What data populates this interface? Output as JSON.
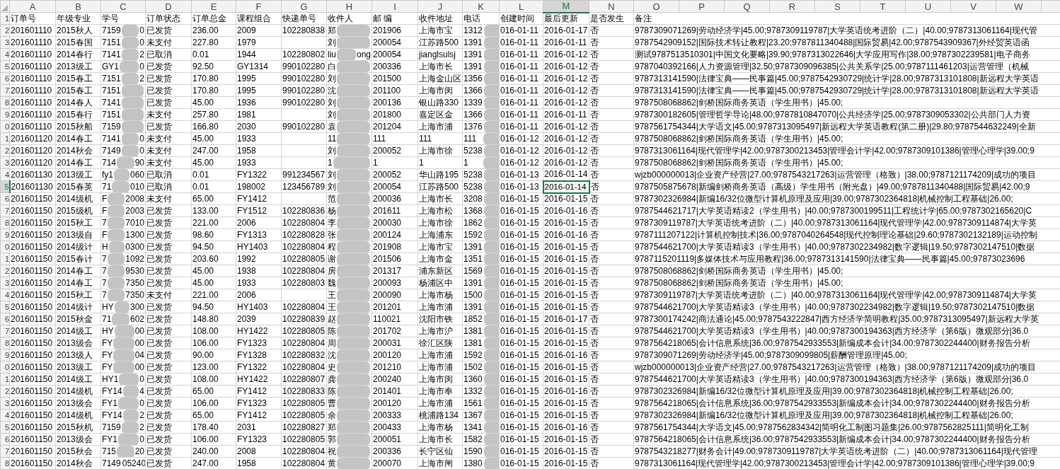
{
  "column_headers": [
    {
      "label": "A",
      "selected": false
    },
    {
      "label": "B",
      "selected": false
    },
    {
      "label": "C",
      "selected": false
    },
    {
      "label": "D",
      "selected": false
    },
    {
      "label": "E",
      "selected": false
    },
    {
      "label": "F",
      "selected": false
    },
    {
      "label": "G",
      "selected": false
    },
    {
      "label": "H",
      "selected": false
    },
    {
      "label": "I",
      "selected": false
    },
    {
      "label": "J",
      "selected": false
    },
    {
      "label": "K",
      "selected": false
    },
    {
      "label": "L",
      "selected": false
    },
    {
      "label": "M",
      "selected": true
    },
    {
      "label": "N",
      "selected": false
    },
    {
      "label": "O",
      "selected": false
    },
    {
      "label": "P",
      "selected": false
    },
    {
      "label": "Q",
      "selected": false
    },
    {
      "label": "R",
      "selected": false
    },
    {
      "label": "S",
      "selected": false
    },
    {
      "label": "T",
      "selected": false
    },
    {
      "label": "U",
      "selected": false
    },
    {
      "label": "V",
      "selected": false
    },
    {
      "label": "W",
      "selected": false
    }
  ],
  "header_row": {
    "row_label": "1",
    "cells": [
      "订单号",
      "年级专业",
      "学号",
      "订单状态",
      "订单总金",
      "课程组合",
      "快递单号",
      "收件人",
      "邮 编",
      "收件地址",
      "电话",
      "创建时间",
      "最后更新",
      "是否发生",
      "备注"
    ]
  },
  "rows": [
    {
      "row_label": "2",
      "selected": false,
      "order_no": "201601110",
      "class_major": "2015秋人",
      "student_id_head": "7159",
      "student_id_tail": "0",
      "status": "已发货",
      "total": "236.00",
      "course_set": "2009",
      "tracking_no": "102280838",
      "recipient_head": "郑",
      "postcode": "201906",
      "address": "上海市宝",
      "phone_head": "1312",
      "created": "016-01-11",
      "updated": "2016-01-17",
      "refund": "否",
      "note": "9787309071269|劳动经济学|45.00;9787309119787|大学英语统考进阶（二）|40.00;9787313061164|现代管"
    },
    {
      "row_label": "3",
      "selected": false,
      "order_no": "201601110",
      "class_major": "2015春国",
      "student_id_head": "7151",
      "student_id_tail": "0",
      "status": "未支付",
      "total": "227.80",
      "course_set": "1979",
      "recipient_head": "刘",
      "postcode": "200054",
      "address": "江苏路500",
      "phone_head": "1391",
      "created": "016-01-11",
      "updated": "2016-01-11",
      "refund": "否",
      "note": "9787542909152|国际技术转让教程|23.20;9787811340488|国际贸易|42.00;9787543909367|外经贸英语函"
    },
    {
      "row_label": "4",
      "selected": false,
      "order_no": "201601110",
      "class_major": "2014春行",
      "student_id_head": "7141",
      "student_id_tail": "2",
      "status": "已取消",
      "total": "0.01",
      "course_set": "1944",
      "tracking_no": "102280802",
      "recipient_head": "liu",
      "recipient_tail": "ong",
      "postcode": "200054",
      "address": "jianglsulsj",
      "phone_head": "1391",
      "created": "016-01-11",
      "updated": "2016-01-12",
      "refund": "否",
      "note": "测试9787513510301|中国文化要略|39.90;9787313022646|大学应用写作|38.00;9787302239581|电子商务"
    },
    {
      "row_label": "5",
      "selected": false,
      "order_no": "201601110",
      "class_major": "2013级工",
      "student_id_head": "GY1",
      "student_id_tail": "0",
      "status": "已发货",
      "total": "92.50",
      "course_set": "GY1314",
      "tracking_no": "990102280",
      "recipient_head": "白",
      "postcode": "200336",
      "address": "上海市长",
      "phone_head": "1391",
      "created": "016-01-11",
      "updated": "2016-01-12",
      "refund": "否",
      "note": "9787040392166|人力资源管理|32.50;9787309096385|公共关系学|25.00;9787111461203|运营管理（机械"
    },
    {
      "row_label": "6",
      "selected": false,
      "order_no": "201601110",
      "class_major": "2015春工",
      "student_id_head": "7151",
      "student_id_tail": "2",
      "status": "已发货",
      "total": "170.80",
      "course_set": "1995",
      "tracking_no": "990102280",
      "recipient_head": "刘",
      "postcode": "201500",
      "address": "上海金山区",
      "phone_head": "1356",
      "created": "016-01-11",
      "updated": "2016-01-12",
      "refund": "否",
      "note": "9787313141590|法律宝典——民事篇|45.00;9787542930729|统计学|28.00;9787313101808|新远程大学英语"
    },
    {
      "row_label": "7",
      "selected": false,
      "order_no": "201601110",
      "class_major": "2015春工",
      "student_id_head": "7151",
      "status": "已发货",
      "total": "170.80",
      "course_set": "1995",
      "tracking_no": "990102280",
      "recipient_head": "沈",
      "postcode": "201100",
      "address": "上海市闵",
      "phone_head": "1366",
      "created": "016-01-11",
      "updated": "2016-01-12",
      "refund": "否",
      "note": "9787313141590|法律宝典——民事篇|45.00;9787542930729|统计学|28.00;9787313101808|新远程大学英语"
    },
    {
      "row_label": "8",
      "selected": false,
      "order_no": "201601110",
      "class_major": "2014春人",
      "student_id_head": "7141",
      "status": "已发货",
      "total": "45.00",
      "course_set": "1936",
      "tracking_no": "990102280",
      "recipient_head": "刘",
      "postcode": "200136",
      "address": "银山路330",
      "phone_head": "1339",
      "created": "016-01-11",
      "updated": "2016-01-12",
      "refund": "否",
      "note": "9787508068862|剑桥国际商务英语（学生用书）|45.00;"
    },
    {
      "row_label": "9",
      "selected": false,
      "order_no": "201601110",
      "class_major": "2015春行",
      "student_id_head": "7151",
      "status": "未支付",
      "total": "257.80",
      "course_set": "1981",
      "recipient_head": "刘",
      "postcode": "201800",
      "address": "嘉定区金",
      "phone_head": "1366",
      "created": "016-01-11",
      "updated": "2016-01-11",
      "refund": "否",
      "note": "9787300182605|管理哲学导论|48.00;9787810847070|公共经济学|25.00;9787309053302|公共部门人力资"
    },
    {
      "row_label": "0",
      "selected": false,
      "order_no": "201601110",
      "class_major": "2015秋船",
      "student_id_head": "7159",
      "status": "已发货",
      "total": "166.80",
      "course_set": "2030",
      "tracking_no": "990102280",
      "recipient_head": "袁",
      "postcode": "201204",
      "address": "上海市浦",
      "phone_head": "1376",
      "created": "016-01-11",
      "updated": "2016-01-12",
      "refund": "否",
      "note": "9787561754344|大学语文|45.00;9787313095497|新远程大学英语教程(第二册)|29.80;9787544632249|全新"
    },
    {
      "row_label": "1",
      "selected": false,
      "order_no": "201601120",
      "class_major": "2014春工",
      "student_id_head": "7141",
      "student_id_tail": "0",
      "status": "未支付",
      "total": "45.00",
      "course_set": "1933",
      "recipient_head": "11",
      "postcode": "111",
      "address": "111",
      "phone_head": "111",
      "created": "016-01-12",
      "updated": "2016-01-12",
      "refund": "否",
      "note": "9787508068862|剑桥国际商务英语（学生用书）|45.00;"
    },
    {
      "row_label": "2",
      "selected": false,
      "order_no": "201601120",
      "class_major": "2014秋会",
      "student_id_head": "7149",
      "student_id_tail": "0",
      "status": "未支付",
      "total": "247.00",
      "course_set": "1958",
      "recipient_head": "刘",
      "postcode": "200052",
      "address": "上海市徐",
      "phone_head": "5238",
      "created": "016-01-12",
      "updated": "2016-01-12",
      "refund": "否",
      "note": "9787313061164|现代管理学|42.00;9787300213453|管理会计学|42.00;9787309101386|管理心理学|39.00;9"
    },
    {
      "row_label": "3",
      "selected": false,
      "order_no": "201601120",
      "class_major": "2014春工",
      "student_id_head": "714",
      "student_id_tail": "90",
      "status": "未支付",
      "total": "45.00",
      "course_set": "1933",
      "recipient_head": "1",
      "postcode": "1",
      "address": "1",
      "phone_head": "1",
      "created": "016-01-12",
      "updated": "2016-01-12",
      "refund": "否",
      "note": "9787508068862|剑桥国际商务英语（学生用书）|45.00;"
    },
    {
      "row_label": "4",
      "selected": false,
      "order_no": "201601130",
      "class_major": "2013级工",
      "student_id_head": "fy1",
      "student_id_tail": "060",
      "status": "已取消",
      "total": "0.01",
      "course_set": "FY1322",
      "tracking_no": "991234567",
      "recipient_head": "刘",
      "postcode": "200052",
      "address": "华山路195",
      "phone_head": "5238",
      "created": "016-01-13",
      "updated": "2016-01-14",
      "refund": "否",
      "note": "wjzb000000013|企业资产经营|27.00;9787543217263|运营管理（格致）|38.00;9787121174209|成功的项目"
    },
    {
      "row_label": "5",
      "selected": true,
      "order_no": "201601130",
      "class_major": "2015春英",
      "student_id_head": "71",
      "student_id_tail": "010",
      "status": "已取消",
      "total": "0.01",
      "course_set": "198002",
      "tracking_no": "123456789",
      "recipient_head": "刘",
      "postcode": "200054",
      "address": "江苏路500",
      "phone_head": "5238",
      "created": "016-01-13",
      "updated": "2016-01-14",
      "refund": "否",
      "note": "9787505875678|新编剑桥商务英语（高级）学生用书（附光盘）|49.00;9787811340488|国际贸易|42.00;9"
    },
    {
      "row_label": "6",
      "selected": false,
      "order_no": "201601150",
      "class_major": "2014级机",
      "student_id_head": "F",
      "student_id_tail": "2008",
      "status": "未支付",
      "total": "65.00",
      "course_set": "FY1412",
      "recipient_head": "范",
      "postcode": "200036",
      "address": "上海市长",
      "phone_head": "3208",
      "created": "016-01-15",
      "updated": "2016-01-15",
      "refund": "否",
      "note": "9787302326984|新编16/32位微型计算机原理及应用|39.00;9787302364818|机械控制工程基础|26.00;"
    },
    {
      "row_label": "7",
      "selected": false,
      "order_no": "201601150",
      "class_major": "2015级机",
      "student_id_head": "F",
      "student_id_tail": "2003",
      "status": "已发货",
      "total": "133.00",
      "course_set": "FY1512",
      "tracking_no": "102280836",
      "recipient_head": "杨",
      "postcode": "201611",
      "address": "上海市松",
      "phone_head": "1368",
      "created": "016-01-15",
      "updated": "2016-01-16",
      "refund": "否",
      "note": "9787544621717|大学英语精读2（学生用书）|40.00;9787300199511|工程统计学|65.00;9787302165620|C"
    },
    {
      "row_label": "8",
      "selected": false,
      "order_no": "201601150",
      "class_major": "2015秋工",
      "student_id_head": "7",
      "student_id_tail": "7010",
      "status": "已发货",
      "total": "221.00",
      "course_set": "2006",
      "tracking_no": "102280804",
      "recipient_head": "李",
      "postcode": "200030",
      "address": "上海市徐",
      "phone_head": "1862",
      "created": "016-01-15",
      "updated": "2016-01-15",
      "refund": "否",
      "note": "9787309119787|大学英语统考进阶（二）|40.00;9787313061164|现代管理学|42.00;9787309114874|大学英"
    },
    {
      "row_label": "9",
      "selected": false,
      "order_no": "201601150",
      "class_major": "2013级自",
      "student_id_head": "F",
      "student_id_tail": "1300",
      "status": "已发货",
      "total": "98.60",
      "course_set": "FY1313",
      "tracking_no": "102280828",
      "recipient_head": "张",
      "postcode": "200124",
      "address": "上海浦东",
      "phone_head": "1592",
      "created": "016-01-15",
      "updated": "2016-01-16",
      "refund": "否",
      "note": "9787111207122|计算机控制技术|36.00;9787040264548|现代控制理论基础|29.60;9787302132189|运动控制"
    },
    {
      "row_label": "0",
      "selected": false,
      "order_no": "201601150",
      "class_major": "2014级计",
      "student_id_head": "H",
      "student_id_tail": "0300",
      "status": "已发货",
      "total": "94.50",
      "course_set": "HY1403",
      "tracking_no": "102280804",
      "recipient_head": "程",
      "postcode": "201908",
      "address": "上海市宝",
      "phone_head": "1391",
      "created": "016-01-15",
      "updated": "2016-01-15",
      "refund": "否",
      "note": "9787544621700|大学英语精读3（学生用书）|40.00;9787302234982|数字逻辑|19.50;9787302147510|数据"
    },
    {
      "row_label": "1",
      "selected": false,
      "order_no": "201601150",
      "class_major": "2015春计",
      "student_id_head": "7",
      "student_id_tail": "1092",
      "status": "已发货",
      "total": "203.60",
      "course_set": "1992",
      "tracking_no": "102280805",
      "recipient_head": "谢",
      "postcode": "201506",
      "address": "上海市金",
      "phone_head": "1351",
      "created": "016-01-15",
      "updated": "2016-01-15",
      "refund": "否",
      "note": "9787115201119|多媒体技术与应用教程|36.00;9787313141590|法律宝典——民事篇|45.00;97873023696"
    },
    {
      "row_label": "2",
      "selected": false,
      "order_no": "201601150",
      "class_major": "2014春工",
      "student_id_head": "7",
      "student_id_tail": "9530",
      "status": "已发货",
      "total": "45.00",
      "course_set": "1938",
      "tracking_no": "102280804",
      "recipient_head": "房",
      "postcode": "201317",
      "address": "浦东新区",
      "phone_head": "1569",
      "created": "016-01-15",
      "updated": "2016-01-15",
      "refund": "否",
      "note": "9787508068862|剑桥国际商务英语（学生用书）|45.00;"
    },
    {
      "row_label": "3",
      "selected": false,
      "order_no": "201601150",
      "class_major": "2014春工",
      "student_id_head": "7",
      "student_id_tail": "7350",
      "status": "已发货",
      "total": "45.00",
      "course_set": "1933",
      "tracking_no": "102280803",
      "recipient_head": "魏",
      "postcode": "200093",
      "address": "杨浦区中",
      "phone_head": "1391",
      "created": "016-01-15",
      "updated": "2016-01-15",
      "refund": "否",
      "note": "9787508068862|剑桥国际商务英语（学生用书）|45.00;"
    },
    {
      "row_label": "4",
      "selected": false,
      "order_no": "201601150",
      "class_major": "2015秋工",
      "student_id_head": "7",
      "student_id_tail": "7350",
      "status": "未支付",
      "total": "221.00",
      "course_set": "2006",
      "recipient_head": "王",
      "postcode": "200090",
      "address": "上海市杨",
      "phone_head": "1500",
      "created": "016-01-15",
      "updated": "2016-01-15",
      "refund": "否",
      "note": "9787309119787|大学英语统考进阶（二）|40.00;9787313061164|现代管理学|42.00;9787309114874|大学英"
    },
    {
      "row_label": "5",
      "selected": false,
      "order_no": "201601150",
      "class_major": "2014级计",
      "student_id_head": "HY",
      "student_id_tail": "300",
      "status": "已发货",
      "total": "94.50",
      "course_set": "HY1403",
      "tracking_no": "102280804",
      "recipient_head": "王",
      "postcode": "201201",
      "address": "上海市浦",
      "phone_head": "1391",
      "created": "016-01-15",
      "updated": "2016-01-15",
      "refund": "否",
      "note": "9787544621700|大学英语精读3（学生用书）|40.00;9787302234982|数字逻辑|19.50;9787302147510|数据"
    },
    {
      "row_label": "6",
      "selected": false,
      "order_no": "201601150",
      "class_major": "2015秋金",
      "student_id_head": "71",
      "student_id_tail": "602",
      "status": "已发货",
      "total": "148.80",
      "course_set": "2039",
      "tracking_no": "102280839",
      "recipient_head": "赵",
      "postcode": "110021",
      "address": "沈阳市铁",
      "phone_head": "1852",
      "created": "016-01-15",
      "updated": "2016-01-17",
      "refund": "否",
      "note": "9787300174242|商法通论|45.00;9787543222847|西方经济学简明教程|35.00;9787313095497|新远程大学英"
    },
    {
      "row_label": "7",
      "selected": false,
      "order_no": "201601150",
      "class_major": "2014级工",
      "student_id_head": "HY",
      "student_id_tail": "00",
      "status": "已发货",
      "total": "108.00",
      "course_set": "HY1422",
      "tracking_no": "102280805",
      "recipient_head": "陈",
      "postcode": "201702",
      "address": "上海市沪",
      "phone_head": "1381",
      "created": "016-01-15",
      "updated": "2016-01-15",
      "refund": "否",
      "note": "9787544621700|大学英语精读3（学生用书）|40.00;9787300194363|西方经济学（第6版）微观部分|36.0"
    },
    {
      "row_label": "8",
      "selected": false,
      "order_no": "201601150",
      "class_major": "2013级会",
      "student_id_head": "FY",
      "student_id_tail": "00",
      "status": "已发货",
      "total": "106.00",
      "course_set": "FY1323",
      "tracking_no": "102280804",
      "recipient_head": "周",
      "postcode": "200031",
      "address": "徐汇区陕",
      "phone_head": "1381",
      "created": "016-01-15",
      "updated": "2016-01-15",
      "refund": "否",
      "note": "9787564218065|会计信息系统|36.00;9787542933553|新编成本会计|34.00;9787302244400|财务报告分析"
    },
    {
      "row_label": "9",
      "selected": false,
      "order_no": "201601150",
      "class_major": "2013级人",
      "student_id_head": "FY",
      "student_id_tail": "04",
      "status": "已发货",
      "total": "90.00",
      "course_set": "FY1328",
      "tracking_no": "102280832",
      "recipient_head": "沈",
      "postcode": "200120",
      "address": "上海市浦",
      "phone_head": "1592",
      "created": "016-01-15",
      "updated": "2016-01-16",
      "refund": "否",
      "note": "9787309071269|劳动经济学|45.00;9787309099805|薪酬管理原理|45.00;"
    },
    {
      "row_label": "0",
      "selected": false,
      "order_no": "201601150",
      "class_major": "2013级工",
      "student_id_head": "FY",
      "student_id_tail": "00",
      "status": "已发货",
      "total": "123.00",
      "course_set": "FY1322",
      "tracking_no": "102280804",
      "recipient_head": "史",
      "postcode": "201210",
      "address": "上海市浦",
      "phone_head": "1502",
      "created": "016-01-15",
      "updated": "2016-01-15",
      "refund": "否",
      "note": "wjzb000000013|企业资产经营|27.00;9787543217263|运营管理（格致）|38.00;9787121174209|成功的项目"
    },
    {
      "row_label": "1",
      "selected": false,
      "order_no": "201601150",
      "class_major": "2014级工",
      "student_id_head": "HY1",
      "student_id_tail": "0",
      "status": "已发货",
      "total": "108.00",
      "course_set": "HY1422",
      "tracking_no": "102280807",
      "recipient_head": "龚",
      "postcode": "200240",
      "address": "上海市闵",
      "phone_head": "1360",
      "created": "016-01-15",
      "updated": "2016-01-15",
      "refund": "否",
      "note": "9787544621700|大学英语精读3（学生用书）|40.00;9787300194363|西方经济学（第6版）微观部分|36.0"
    },
    {
      "row_label": "2",
      "selected": false,
      "order_no": "201601150",
      "class_major": "2014级机",
      "student_id_head": "FY14",
      "student_id_tail": "4",
      "status": "已发货",
      "total": "65.00",
      "course_set": "FY1412",
      "tracking_no": "102280833",
      "recipient_head": "陈",
      "postcode": "201401",
      "address": "上海市奉",
      "phone_head": "1332",
      "created": "016-01-15",
      "updated": "2016-01-16",
      "refund": "否",
      "note": "9787302326984|新编16/32位微型计算机原理及应用|39.00;9787302364818|机械控制工程基础|26.00;"
    },
    {
      "row_label": "3",
      "selected": false,
      "order_no": "201601150",
      "class_major": "2013级会",
      "student_id_head": "FY1",
      "student_id_tail": "0",
      "status": "已发货",
      "total": "106.00",
      "course_set": "FY1323",
      "tracking_no": "102280805",
      "recipient_head": "曹",
      "postcode": "200120",
      "address": "上海市浦",
      "phone_head": "1561",
      "created": "016-01-15",
      "updated": "2016-01-15",
      "refund": "否",
      "note": "9787564218065|会计信息系统|36.00;9787542933553|新编成本会计|34.00;9787302244400|财务报告分析"
    },
    {
      "row_label": "4",
      "selected": false,
      "order_no": "201601150",
      "class_major": "2014级机",
      "student_id_head": "FY14",
      "student_id_tail": "2",
      "status": "已发货",
      "total": "65.00",
      "course_set": "FY1412",
      "tracking_no": "102280805",
      "recipient_head": "余",
      "postcode": "200333",
      "address": "桃浦路134",
      "phone_head": "1367",
      "created": "016-01-15",
      "updated": "2016-01-15",
      "refund": "否",
      "note": "9787302326984|新编16/32位微型计算机原理及应用|39.00;9787302364818|机械控制工程基础|26.00;"
    },
    {
      "row_label": "5",
      "selected": false,
      "order_no": "201601150",
      "class_major": "2015秋机",
      "student_id_head": "7159",
      "student_id_tail": "2",
      "status": "已发货",
      "total": "178.40",
      "course_set": "2031",
      "tracking_no": "102280827",
      "recipient_head": "郑",
      "postcode": "200433",
      "address": "上海市杨",
      "phone_head": "1341",
      "created": "016-01-15",
      "updated": "2016-01-16",
      "refund": "否",
      "note": "9787561754344|大学语文|45.00;9787562834342|简明化工制图习题集|26.00;9787562825111|简明化工制"
    },
    {
      "row_label": "6",
      "selected": false,
      "order_no": "201601150",
      "class_major": "2013级会",
      "student_id_head": "FY1",
      "student_id_tail": "0",
      "status": "已发货",
      "total": "106.00",
      "course_set": "FY1323",
      "tracking_no": "102280805",
      "recipient_head": "郭",
      "postcode": "200051",
      "address": "上海市长",
      "phone_head": "1582",
      "created": "016-01-15",
      "updated": "2016-01-15",
      "refund": "否",
      "note": "9787564218065|会计信息系统|36.00;9787542933553|新编成本会计|34.00;9787302244400|财务报告分析"
    },
    {
      "row_label": "7",
      "selected": false,
      "order_no": "201601150",
      "class_major": "2015秋会",
      "student_id_head": "715",
      "student_id_tail": "20",
      "status": "已发货",
      "total": "240.00",
      "course_set": "2008",
      "tracking_no": "102280804",
      "recipient_head": "祝",
      "postcode": "200336",
      "address": "长宁区仙",
      "phone_head": "1590",
      "created": "016-01-15",
      "updated": "2016-01-15",
      "refund": "否",
      "note": "9787543218277|财务会计|49.00;9787309119787|大学英语统考进阶（二）|40.00;9787313061164|现代管理"
    },
    {
      "row_label": "8",
      "selected": false,
      "order_no": "201601150",
      "class_major": "2014秋会",
      "student_id_head": "7149",
      "student_id_tail": "05240",
      "status": "已发货",
      "total": "247.00",
      "course_set": "1958",
      "tracking_no": "102280804",
      "recipient_head": "黄",
      "postcode": "200070",
      "address": "上海市闸",
      "phone_head": "1380",
      "created": "016-01-15",
      "updated": "2016-01-15",
      "refund": "否",
      "note": "9787313061164|现代管理学|42.00;9787300213453|管理会计学|42.00;9787309101386|管理心理学|39.00;9"
    }
  ]
}
